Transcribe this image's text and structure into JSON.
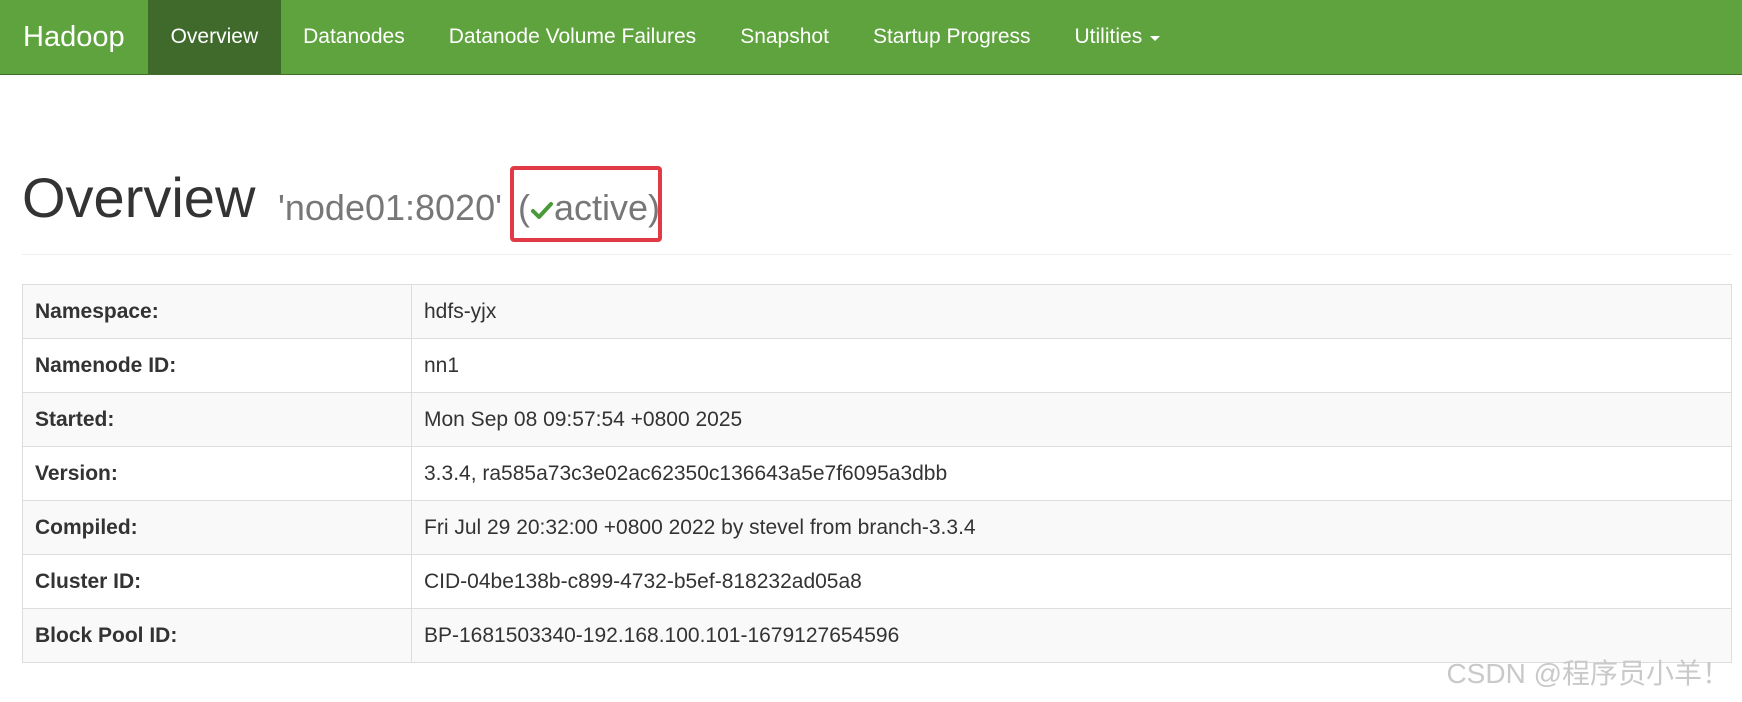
{
  "navbar": {
    "brand": "Hadoop",
    "items": [
      {
        "label": "Overview",
        "active": true
      },
      {
        "label": "Datanodes",
        "active": false
      },
      {
        "label": "Datanode Volume Failures",
        "active": false
      },
      {
        "label": "Snapshot",
        "active": false
      },
      {
        "label": "Startup Progress",
        "active": false
      },
      {
        "label": "Utilities",
        "active": false
      }
    ]
  },
  "header": {
    "title": "Overview",
    "host": "'node01:8020'",
    "state_open": "(",
    "state": "active",
    "state_close": ")",
    "state_icon": "check-icon"
  },
  "info_table": [
    {
      "key": "Namespace:",
      "value": "hdfs-yjx"
    },
    {
      "key": "Namenode ID:",
      "value": "nn1"
    },
    {
      "key": "Started:",
      "value": "Mon Sep 08 09:57:54 +0800 2025"
    },
    {
      "key": "Version:",
      "value": "3.3.4, ra585a73c3e02ac62350c136643a5e7f6095a3dbb"
    },
    {
      "key": "Compiled:",
      "value": "Fri Jul 29 20:32:00 +0800 2022 by stevel from branch-3.3.4"
    },
    {
      "key": "Cluster ID:",
      "value": "CID-04be138b-c899-4732-b5ef-818232ad05a8"
    },
    {
      "key": "Block Pool ID:",
      "value": "BP-1681503340-192.168.100.101-1679127654596"
    }
  ],
  "watermark": "CSDN @程序员小羊！",
  "colors": {
    "navbar_bg": "#5fa33e",
    "navbar_active_bg": "#3f6a2c",
    "highlight_border": "#e23a45",
    "check": "#4a9a3a"
  }
}
